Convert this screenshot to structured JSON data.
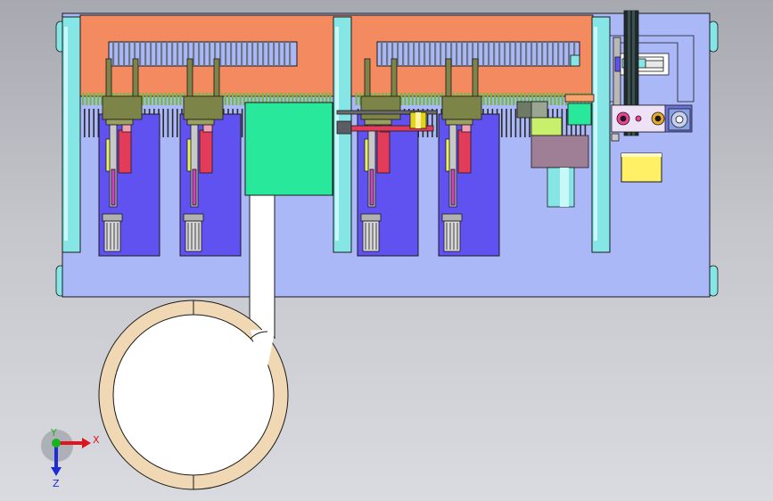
{
  "viewport": {
    "background_top": "#a7a9b0",
    "background_bottom": "#d9dbe0"
  },
  "triad": {
    "x_label": "X",
    "y_label": "Y",
    "z_label": "Z",
    "x_color": "#e0141e",
    "y_color": "#18b41e",
    "z_color": "#1e2cd8"
  },
  "colors": {
    "base_plate": "#aab8f8",
    "top_plate": "#f48a60",
    "column": "#86e6e6",
    "sub_plate": "#6052f0",
    "actuator": "#7d8448",
    "cylinder": "#e23c5a",
    "chip_pad": "#28e89c",
    "ring": "#f0d8b4",
    "inner_disc": "#ffffff",
    "yellow_box": "#fff066",
    "mauve_block": "#9f7f95",
    "outline": "#1a1a1a"
  }
}
